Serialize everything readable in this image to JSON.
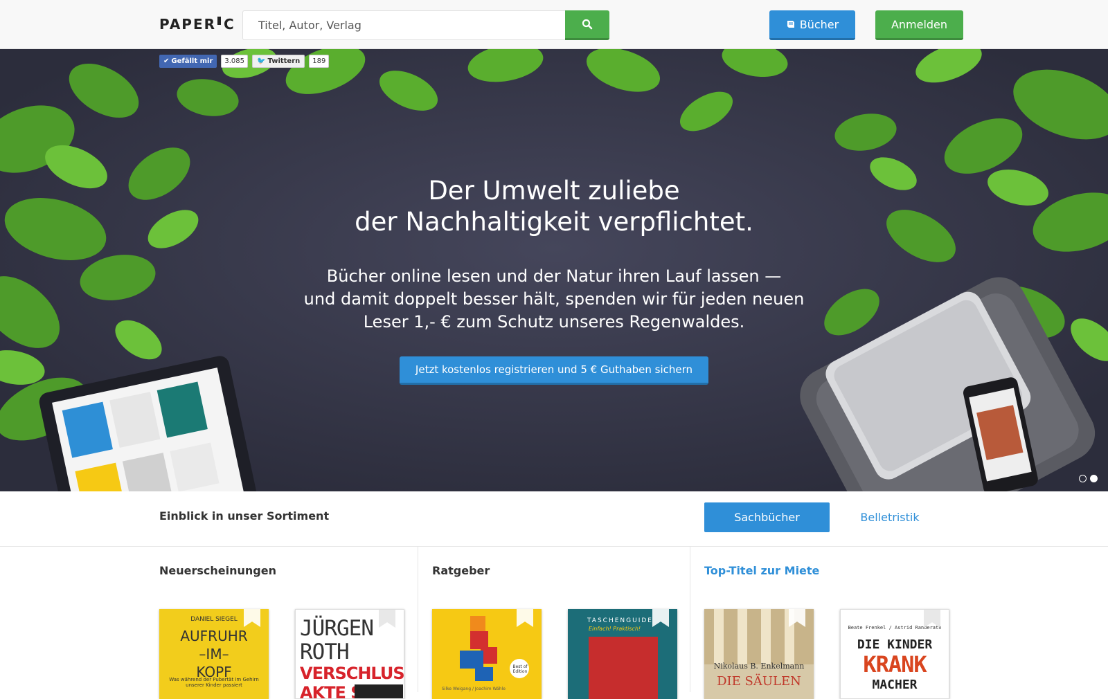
{
  "header": {
    "logo_left": "PAPER",
    "logo_right": "C",
    "search_placeholder": "Titel, Autor, Verlag",
    "search_icon": "search-icon",
    "books_label": "Bücher",
    "books_icon": "book-icon",
    "login_label": "Anmelden"
  },
  "social": {
    "like_label": "Gefällt mir",
    "like_count": "3.085",
    "tweet_label": "Twittern",
    "tweet_count": "189"
  },
  "hero": {
    "title_line1": "Der Umwelt zuliebe",
    "title_line2": "der Nachhaltigkeit verpflichtet.",
    "text_line1": "Bücher online lesen und der Natur ihren Lauf lassen —",
    "text_line2": "und damit doppelt besser hält, spenden wir für jeden neuen",
    "text_line3": "Leser 1,- € zum Schutz unseres Regenwaldes.",
    "cta": "Jetzt kostenlos registrieren und 5 € Guthaben sichern",
    "slides": 2,
    "active_slide": 2
  },
  "sortiment": {
    "title": "Einblick in unser Sortiment",
    "tabs": [
      {
        "label": "Sachbücher",
        "active": true
      },
      {
        "label": "Belletristik",
        "active": false
      }
    ]
  },
  "columns": [
    {
      "title": "Neuerscheinungen",
      "books": [
        {
          "author": "DANIEL SIEGEL",
          "title": "AUFRUHR\n–IM–\nKOPF",
          "subtitle": "Was während der Pubertät im Gehirn unserer Kinder passiert"
        },
        {
          "author_top": "JÜRGEN\nROTH",
          "title": "VERSCHLUSS\nAKTE S"
        }
      ]
    },
    {
      "title": "Ratgeber",
      "books": [
        {
          "badge": "Best of Edition",
          "authors": "Silke Weigang / Joachim Wähle"
        },
        {
          "series": "TASCHENGUIDE",
          "tagline": "Einfach! Praktisch!"
        }
      ]
    },
    {
      "title": "Top-Titel zur Miete",
      "books": [
        {
          "author": "Nikolaus B. Enkelmann",
          "title": "DIE SÄULEN"
        },
        {
          "authors": "Beate Frenkel / Astrid Randerath",
          "title_l1": "DIE KINDER",
          "title_l2": "KRANK",
          "title_l3": "MACHER"
        }
      ]
    }
  ],
  "colors": {
    "blue": "#2f8fd8",
    "green": "#4cae4c",
    "hero_bg": "#3b3c4f"
  }
}
